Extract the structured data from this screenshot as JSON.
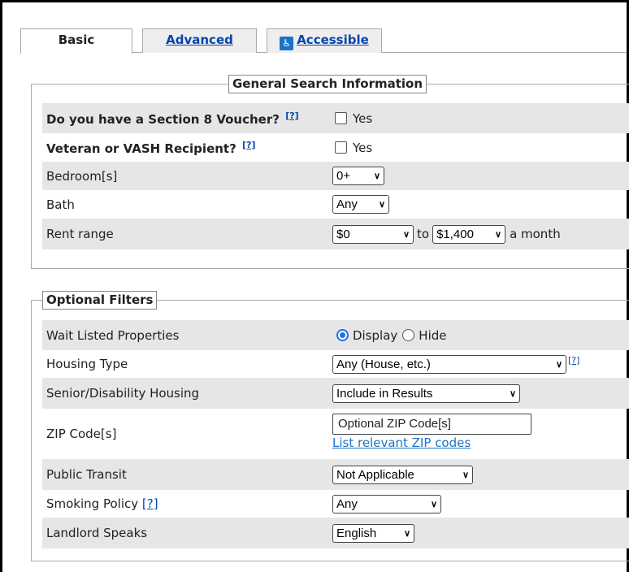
{
  "tabs": {
    "basic": "Basic",
    "advanced": "Advanced",
    "accessible": "Accessible"
  },
  "general": {
    "legend": "General Search Information",
    "help_mark": "[?]",
    "section8_label": "Do you have a Section 8 Voucher?",
    "section8_option": "Yes",
    "veteran_label": "Veteran or VASH Recipient?",
    "veteran_option": "Yes",
    "bedrooms_label": "Bedroom[s]",
    "bedrooms_value": "0+",
    "bath_label": "Bath",
    "bath_value": "Any",
    "rent_label": "Rent range",
    "rent_min": "$0",
    "rent_to": "to",
    "rent_max": "$1,400",
    "rent_suffix": "a month"
  },
  "optional": {
    "legend": "Optional Filters",
    "help_mark": "[?]",
    "waitlist_label": "Wait Listed Properties",
    "waitlist_display": "Display",
    "waitlist_hide": "Hide",
    "housing_type_label": "Housing Type",
    "housing_type_value": "Any (House, etc.)",
    "senior_label": "Senior/Disability Housing",
    "senior_value": "Include in Results",
    "zip_label": "ZIP Code[s]",
    "zip_placeholder": "Optional ZIP Code[s]",
    "zip_link": "List relevant ZIP codes",
    "transit_label": "Public Transit",
    "transit_value": "Not Applicable",
    "smoking_label": "Smoking Policy",
    "smoking_value": "Any",
    "landlord_label": "Landlord Speaks",
    "landlord_value": "English"
  }
}
